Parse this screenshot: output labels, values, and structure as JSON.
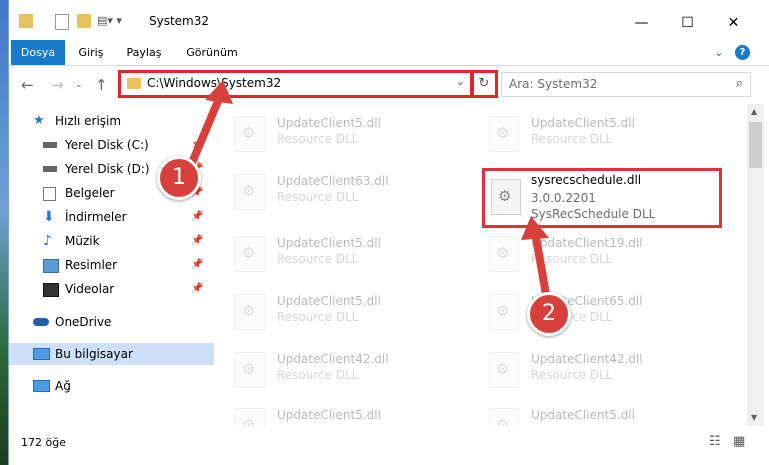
{
  "window": {
    "title": "System32",
    "controls": {
      "minimize": "—",
      "maximize": "☐",
      "close": "✕"
    }
  },
  "ribbon": {
    "tabs": [
      "Dosya",
      "Giriş",
      "Paylaş",
      "Görünüm"
    ],
    "help": "?"
  },
  "address": {
    "path": "C:\\Windows\\System32",
    "chevron": "⌄",
    "refresh": "↻"
  },
  "search": {
    "placeholder": "Ara: System32",
    "icon": "search-icon"
  },
  "nav": {
    "items": [
      {
        "label": "Hızlı erişim",
        "icon": "star-icon",
        "pinned": false
      },
      {
        "label": "Yerel Disk (C:)",
        "icon": "drive-icon",
        "pinned": true
      },
      {
        "label": "Yerel Disk (D:)",
        "icon": "drive-icon",
        "pinned": true
      },
      {
        "label": "Belgeler",
        "icon": "documents-icon",
        "pinned": true
      },
      {
        "label": "İndirmeler",
        "icon": "download-icon",
        "pinned": true
      },
      {
        "label": "Müzik",
        "icon": "music-icon",
        "pinned": true
      },
      {
        "label": "Resimler",
        "icon": "pictures-icon",
        "pinned": true
      },
      {
        "label": "Videolar",
        "icon": "video-icon",
        "pinned": true
      },
      {
        "label": "OneDrive",
        "icon": "cloud-icon",
        "pinned": false
      },
      {
        "label": "Bu bilgisayar",
        "icon": "computer-icon",
        "pinned": false
      },
      {
        "label": "Ağ",
        "icon": "network-icon",
        "pinned": false
      }
    ]
  },
  "files": {
    "left": [
      {
        "name": "UpdateClient5.dll",
        "type": "Resource DLL"
      },
      {
        "name": "UpdateClient63.dll",
        "type": "Resource DLL"
      },
      {
        "name": "UpdateClient5.dll",
        "type": "Resource DLL"
      },
      {
        "name": "UpdateClient5.dll",
        "type": "Resource DLL"
      },
      {
        "name": "UpdateClient42.dll",
        "type": "Resource DLL"
      },
      {
        "name": "UpdateClient5.dll",
        "type": "Resource DLL"
      }
    ],
    "right": [
      {
        "name": "UpdateClient5.dll",
        "type": "Resource DLL"
      },
      {
        "name": "UpdateClient19.dll",
        "type": "Resource DLL"
      },
      {
        "name": "UpdateClient65.dll",
        "type": "Resource DLL"
      },
      {
        "name": "UpdateClient42.dll",
        "type": "Resource DLL"
      },
      {
        "name": "UpdateClient5.dll",
        "type": "Resource DLL"
      }
    ],
    "highlighted": {
      "name": "sysrecschedule.dll",
      "version": "3.0.0.2201",
      "description": "SysRecSchedule DLL"
    }
  },
  "status": {
    "count": "172 öğe"
  },
  "callouts": [
    "1",
    "2"
  ],
  "colors": {
    "accent": "#1979ca",
    "highlight": "#e0262b"
  }
}
